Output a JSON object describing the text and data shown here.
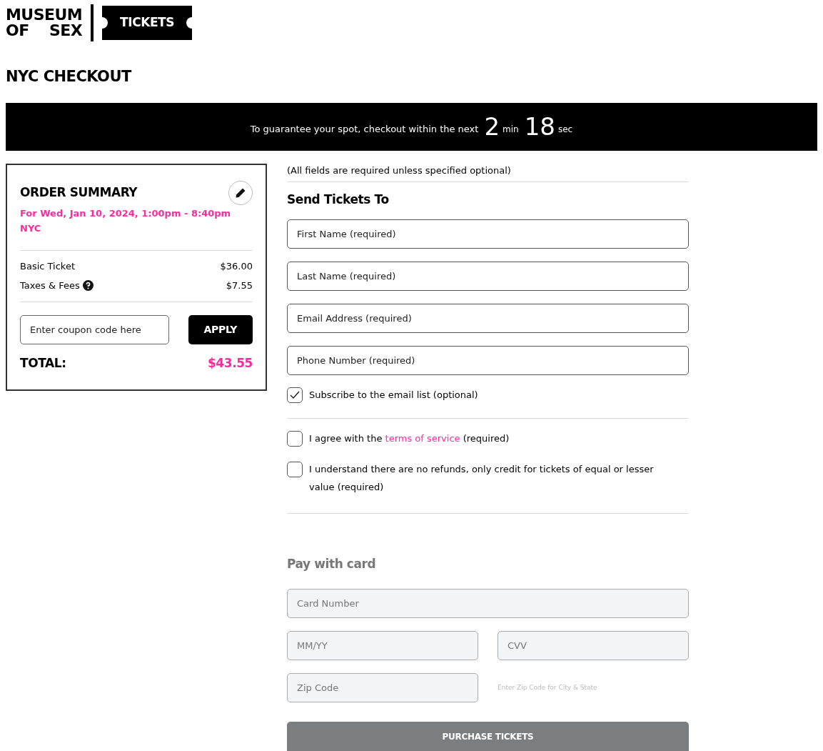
{
  "logo": {
    "line_1": "MUSEUM",
    "line_2_left": "OF",
    "line_2_right": "SEX",
    "ticket": "TICKETS"
  },
  "title": "NYC CHECKOUT",
  "timer": {
    "text": "To guarantee your spot, checkout within the next",
    "minutes": "2",
    "minutes_unit": "min",
    "seconds": "18",
    "seconds_unit": "sec"
  },
  "order_summary": {
    "title": "ORDER SUMMARY",
    "date": "For Wed, Jan 10, 2024, 1:00pm - 8:40pm",
    "location": "NYC",
    "lines": [
      {
        "label": "Basic Ticket",
        "amount": "$36.00",
        "help": false
      },
      {
        "label": "Taxes & Fees",
        "amount": "$7.55",
        "help": true
      }
    ],
    "coupon": {
      "placeholder": "Enter coupon code here"
    },
    "apply": "APPLY",
    "total_label": "TOTAL:",
    "total": "$43.55"
  },
  "form": {
    "note": "(All fields are required unless specified optional)",
    "heading": "Send Tickets To",
    "fields": [
      {
        "placeholder": "First Name (required)"
      },
      {
        "placeholder": "Last Name (required)"
      },
      {
        "placeholder": "Email Address (required)"
      },
      {
        "placeholder": "Phone Number (required)"
      }
    ],
    "subscribe": {
      "label": "Subscribe to the email list (optional)",
      "checked": true
    },
    "agreements": [
      {
        "text_before": "I agree with the",
        "link": "terms of service",
        "text_after": "(required)",
        "checked": false
      },
      {
        "text_before": "I understand there are no refunds, only credit for tickets of equal or lesser value (required)",
        "checked": false
      }
    ]
  },
  "payment": {
    "heading": "Pay with card",
    "card_number": {
      "placeholder": "Card Number"
    },
    "expiry": {
      "placeholder": "MM/YY"
    },
    "cvv": {
      "placeholder": "CVV"
    },
    "zip": {
      "placeholder": "Zip Code"
    },
    "zip_hint": "Enter Zip Code for City & State",
    "purchase": {
      "label": "PURCHASE TICKETS",
      "disabled": true
    }
  }
}
